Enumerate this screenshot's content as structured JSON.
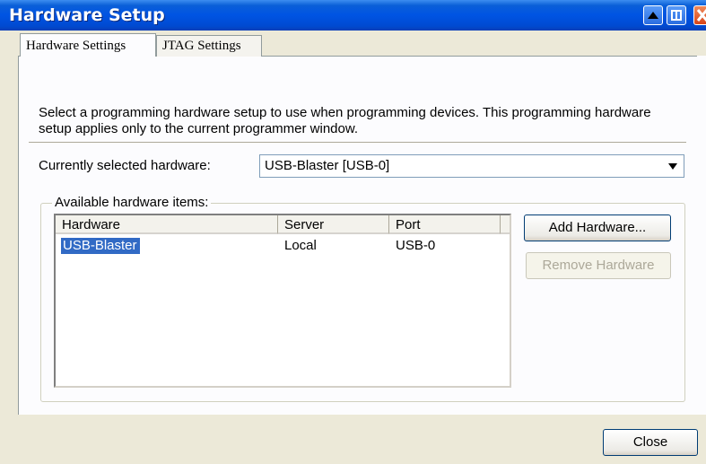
{
  "window": {
    "title": "Hardware Setup"
  },
  "tabs": [
    {
      "label": "Hardware Settings",
      "active": true
    },
    {
      "label": "JTAG Settings",
      "active": false
    }
  ],
  "description": "Select a programming hardware setup to use when programming devices. This programming hardware setup applies only to the current programmer window.",
  "current_hardware": {
    "label": "Currently selected hardware:",
    "value": "USB-Blaster [USB-0]"
  },
  "available": {
    "label": "Available hardware items:",
    "columns": [
      "Hardware",
      "Server",
      "Port"
    ],
    "rows": [
      {
        "hardware": "USB-Blaster",
        "server": "Local",
        "port": "USB-0",
        "selected": true
      }
    ]
  },
  "buttons": {
    "add": "Add Hardware...",
    "remove": "Remove Hardware",
    "close": "Close"
  },
  "icons": [
    "up-arrow-icon",
    "restore-icon",
    "close-icon"
  ],
  "colors": {
    "titlebar": "#0054e3",
    "selection": "#316ac5",
    "dialog": "#ece9d8"
  }
}
